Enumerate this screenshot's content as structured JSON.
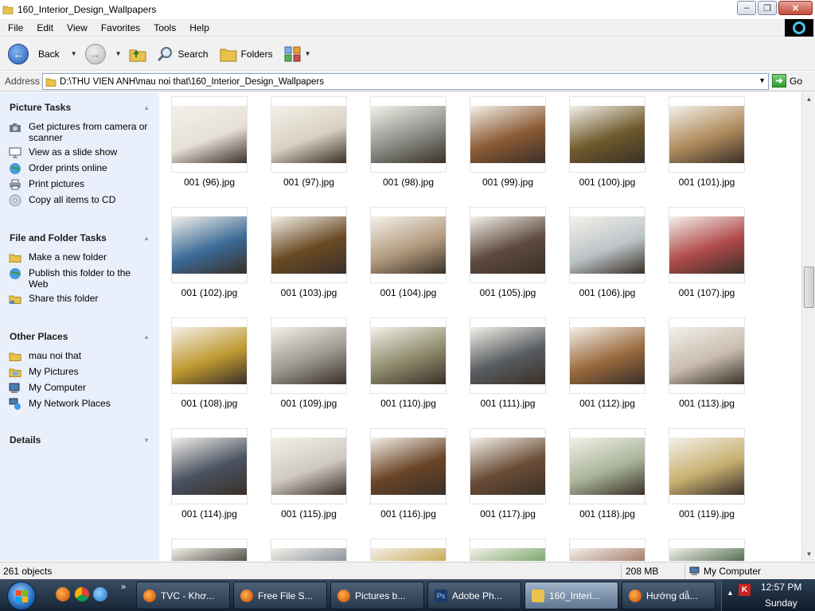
{
  "window": {
    "title": "160_Interior_Design_Wallpapers"
  },
  "menu": [
    "File",
    "Edit",
    "View",
    "Favorites",
    "Tools",
    "Help"
  ],
  "toolbar": {
    "back": "Back",
    "search": "Search",
    "folders": "Folders"
  },
  "address": {
    "label": "Address",
    "path": "D:\\THU VIEN ANH\\mau noi that\\160_Interior_Design_Wallpapers",
    "go": "Go"
  },
  "sidebar": {
    "picture_tasks": {
      "title": "Picture Tasks",
      "items": [
        "Get pictures from camera or scanner",
        "View as a slide show",
        "Order prints online",
        "Print pictures",
        "Copy all items to CD"
      ]
    },
    "file_tasks": {
      "title": "File and Folder Tasks",
      "items": [
        "Make a new folder",
        "Publish this folder to the Web",
        "Share this folder"
      ]
    },
    "other_places": {
      "title": "Other Places",
      "items": [
        "mau noi that",
        "My Pictures",
        "My Computer",
        "My Network Places"
      ]
    },
    "details": {
      "title": "Details"
    }
  },
  "files": [
    {
      "name": "001 (96).jpg",
      "tone": "#e6e0d6"
    },
    {
      "name": "001 (97).jpg",
      "tone": "#d9d1c2"
    },
    {
      "name": "001 (98).jpg",
      "tone": "#8a8e86"
    },
    {
      "name": "001 (99).jpg",
      "tone": "#8b5a34"
    },
    {
      "name": "001 (100).jpg",
      "tone": "#6e5a2c"
    },
    {
      "name": "001 (101).jpg",
      "tone": "#b08a5c"
    },
    {
      "name": "001 (102).jpg",
      "tone": "#3a6a96"
    },
    {
      "name": "001 (103).jpg",
      "tone": "#6a4a24"
    },
    {
      "name": "001 (104).jpg",
      "tone": "#b29a7e"
    },
    {
      "name": "001 (105).jpg",
      "tone": "#5e4a3e"
    },
    {
      "name": "001 (106).jpg",
      "tone": "#bcc4c8"
    },
    {
      "name": "001 (107).jpg",
      "tone": "#b04a4a"
    },
    {
      "name": "001 (108).jpg",
      "tone": "#c09a32"
    },
    {
      "name": "001 (109).jpg",
      "tone": "#9a9690"
    },
    {
      "name": "001 (110).jpg",
      "tone": "#8e8a6c"
    },
    {
      "name": "001 (111).jpg",
      "tone": "#585c60"
    },
    {
      "name": "001 (112).jpg",
      "tone": "#9a6a3e"
    },
    {
      "name": "001 (113).jpg",
      "tone": "#c8bcae"
    },
    {
      "name": "001 (114).jpg",
      "tone": "#4a5262"
    },
    {
      "name": "001 (115).jpg",
      "tone": "#cfc9c0"
    },
    {
      "name": "001 (116).jpg",
      "tone": "#6a4426"
    },
    {
      "name": "001 (117).jpg",
      "tone": "#6a4c36"
    },
    {
      "name": "001 (118).jpg",
      "tone": "#a8b498"
    },
    {
      "name": "001 (119).jpg",
      "tone": "#c8b070"
    },
    {
      "name": "",
      "tone": "#3a3630"
    },
    {
      "name": "",
      "tone": "#7a8490"
    },
    {
      "name": "",
      "tone": "#c0a040"
    },
    {
      "name": "",
      "tone": "#6a9a5a"
    },
    {
      "name": "",
      "tone": "#9a6a5a"
    },
    {
      "name": "",
      "tone": "#3a5a3a"
    }
  ],
  "status": {
    "objects": "261 objects",
    "size": "208 MB",
    "location": "My Computer"
  },
  "taskbar": {
    "buttons": [
      "TVC - Khơ...",
      "Free File S...",
      "Pictures b...",
      "Adobe Ph...",
      "160_Interi...",
      "Hướng dẫ..."
    ],
    "time": "12:57 PM",
    "day": "Sunday"
  },
  "colors": {
    "sidebar_bg": "#e9f0fb",
    "taskbar": "#1e3044",
    "selection": "#2a5fb7"
  }
}
